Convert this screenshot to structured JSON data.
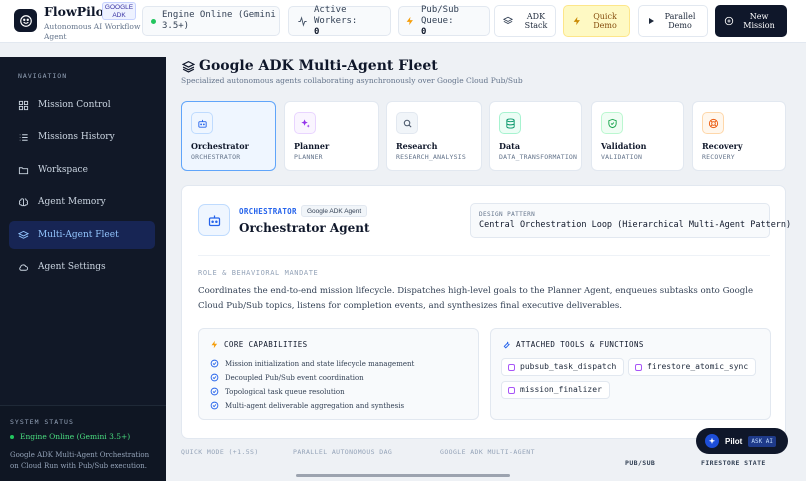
{
  "app": {
    "name": "FlowPilot",
    "badge": "GOOGLE ADK",
    "subtitle": "Autonomous AI Workflow Agent"
  },
  "status_bar": {
    "engine": "Engine Online (Gemini 3.5+)",
    "workers_label": "Active Workers:",
    "workers_value": "0",
    "queue_label": "Pub/Sub Queue:",
    "queue_value": "0"
  },
  "toolbar": {
    "adk_stack": "ADK Stack",
    "quick_demo": "Quick Demo",
    "parallel_demo": "Parallel Demo",
    "new_mission": "New Mission"
  },
  "sidebar": {
    "heading": "NAVIGATION",
    "items": [
      {
        "label": "Mission Control",
        "icon": "grid-icon"
      },
      {
        "label": "Missions History",
        "icon": "list-icon"
      },
      {
        "label": "Workspace",
        "icon": "folder-icon"
      },
      {
        "label": "Agent Memory",
        "icon": "brain-icon"
      },
      {
        "label": "Multi-Agent Fleet",
        "icon": "layers-icon"
      },
      {
        "label": "Agent Settings",
        "icon": "cloud-icon"
      }
    ],
    "active_index": 4,
    "system_status": {
      "heading": "SYSTEM STATUS",
      "status": "Engine Online (Gemini 3.5+)",
      "description": "Google ADK Multi-Agent Orchestration on Cloud Run with Pub/Sub execution."
    }
  },
  "main": {
    "title": "Google ADK Multi-Agent Fleet",
    "subtitle": "Specialized autonomous agents collaborating asynchronously over Google Cloud Pub/Sub",
    "agents": [
      {
        "name": "Orchestrator",
        "code": "ORCHESTRATOR",
        "icon": "bot-icon",
        "color": "#2563eb",
        "bg": "#eff6ff"
      },
      {
        "name": "Planner",
        "code": "PLANNER",
        "icon": "sparkles-icon",
        "color": "#9333ea",
        "bg": "#faf5ff"
      },
      {
        "name": "Research",
        "code": "RESEARCH_ANALYSIS",
        "icon": "search-icon",
        "color": "#475569",
        "bg": "#f1f5f9"
      },
      {
        "name": "Data",
        "code": "DATA_TRANSFORMATION",
        "icon": "database-icon",
        "color": "#059669",
        "bg": "#ecfdf5"
      },
      {
        "name": "Validation",
        "code": "VALIDATION",
        "icon": "shield-check-icon",
        "color": "#16a34a",
        "bg": "#f0fdf4"
      },
      {
        "name": "Recovery",
        "code": "RECOVERY",
        "icon": "life-buoy-icon",
        "color": "#ea580c",
        "bg": "#fff7ed"
      }
    ],
    "selected_index": 0,
    "detail": {
      "label": "ORCHESTRATOR",
      "badge": "Google ADK Agent",
      "title": "Orchestrator Agent",
      "pattern_label": "DESIGN PATTERN",
      "pattern_value": "Central Orchestration Loop (Hierarchical Multi-Agent Pattern)",
      "mandate_heading": "ROLE & BEHAVIORAL MANDATE",
      "mandate": "Coordinates the end-to-end mission lifecycle. Dispatches high-level goals to the Planner Agent, enqueues subtasks onto Google Cloud Pub/Sub topics, listens for completion events, and synthesizes final executive deliverables.",
      "capabilities_heading": "CORE CAPABILITIES",
      "capabilities": [
        "Mission initialization and state lifecycle management",
        "Decoupled Pub/Sub event coordination",
        "Topological task queue resolution",
        "Multi-agent deliverable aggregation and synthesis"
      ],
      "tools_heading": "ATTACHED TOOLS & FUNCTIONS",
      "tools": [
        "pubsub_task_dispatch",
        "firestore_atomic_sync",
        "mission_finalizer"
      ]
    },
    "footer": {
      "quick_mode": "QUICK MODE (+1.5S)",
      "parallel": "PARALLEL AUTONOMOUS DAG",
      "adk": "GOOGLE ADK MULTI-AGENT",
      "pubsub": "PUB/SUB",
      "firestore": "FIRESTORE STATE"
    }
  },
  "pilot": {
    "label": "Pilot",
    "tag": "ASK AI"
  }
}
